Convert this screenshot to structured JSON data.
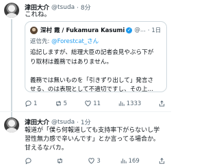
{
  "tweets": [
    {
      "name": "津田大介",
      "handle": "@tsuda",
      "time": "· 8分",
      "text": "これね。",
      "quote": {
        "name": "深村 霞 / Fukamura Kasumi",
        "handle": "@...",
        "time": "· 1日",
        "reply_prefix": "返信先:",
        "reply_to": "@Forestcat_さん",
        "lines": [
          "追記しますが、総理大臣の記者会見やぶら下が",
          "り取材は義務ではありません。",
          "",
          "義務では無いものを「引きずり出して」発言さ",
          "せる、のは表現として不適切ですし、その上..."
        ]
      },
      "actions": {
        "reply": "1",
        "retweet": "5",
        "like": "11",
        "views": "1333"
      }
    },
    {
      "name": "津田大介",
      "handle": "@tsuda",
      "time": "· 1分",
      "lines": [
        "報道が「僕ら何報道しても支持率下がらないし学",
        "習性無力感で辛いんです」とか言ってる場合か。",
        "甘えるなバカ。"
      ],
      "actions": {
        "reply": "",
        "retweet": "",
        "like": "3",
        "views": "169"
      }
    }
  ]
}
